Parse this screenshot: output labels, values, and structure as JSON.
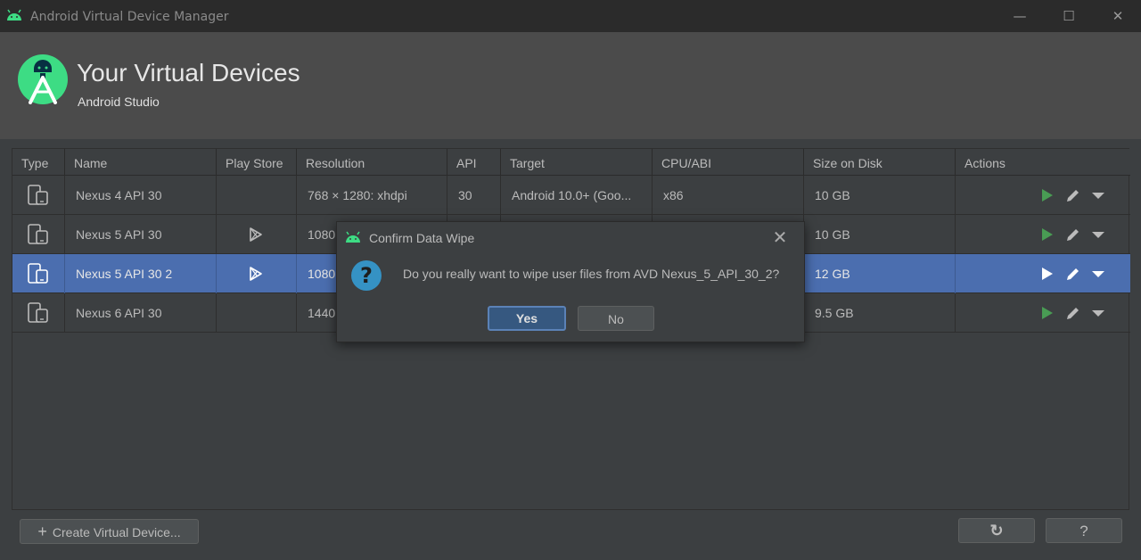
{
  "window": {
    "title": "Android Virtual Device Manager",
    "controls": {
      "minimize": "—",
      "maximize": "☐",
      "close": "✕"
    }
  },
  "header": {
    "title": "Your Virtual Devices",
    "subtitle": "Android Studio"
  },
  "table": {
    "columns": [
      "Type",
      "Name",
      "Play Store",
      "Resolution",
      "API",
      "Target",
      "CPU/ABI",
      "Size on Disk",
      "Actions"
    ],
    "rows": [
      {
        "type_icon": "phone-tablet-icon",
        "name": "Nexus 4 API 30",
        "play_store": false,
        "resolution": "768 × 1280: xhdpi",
        "api": "30",
        "target": "Android 10.0+ (Goo...",
        "cpu": "x86",
        "size": "10 GB",
        "selected": false
      },
      {
        "type_icon": "phone-tablet-icon",
        "name": "Nexus 5 API 30",
        "play_store": true,
        "resolution": "1080",
        "api": "",
        "target": "",
        "cpu": "",
        "size": "10 GB",
        "selected": false
      },
      {
        "type_icon": "phone-tablet-icon",
        "name": "Nexus 5 API 30 2",
        "play_store": true,
        "resolution": "1080",
        "api": "",
        "target": "",
        "cpu": "",
        "size": "12 GB",
        "selected": true
      },
      {
        "type_icon": "phone-tablet-icon",
        "name": "Nexus 6 API 30",
        "play_store": false,
        "resolution": "1440",
        "api": "",
        "target": "",
        "cpu": "",
        "size": "9.5 GB",
        "selected": false
      }
    ]
  },
  "dialog": {
    "title": "Confirm Data Wipe",
    "message": "Do you really want to wipe user files from AVD Nexus_5_API_30_2?",
    "yes_label": "Yes",
    "no_label": "No",
    "close_glyph": "✕",
    "question_glyph": "?"
  },
  "footer": {
    "create_label": "Create Virtual Device...",
    "create_glyph": "+",
    "refresh_glyph": "↻",
    "help_label": "?"
  },
  "colors": {
    "accent": "#4b6eaf",
    "play_green": "#499c54",
    "android_green": "#3ddc84"
  }
}
